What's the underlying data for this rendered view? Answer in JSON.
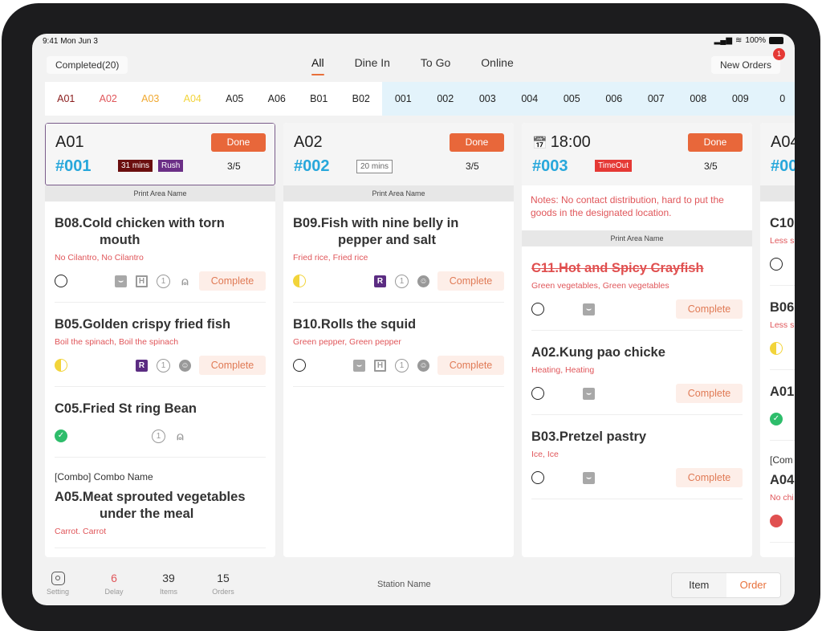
{
  "status_bar": {
    "time": "9:41 Mon Jun 3",
    "battery": "100%"
  },
  "top": {
    "completed": "Completed(20)",
    "tabs": [
      "All",
      "Dine In",
      "To Go",
      "Online"
    ],
    "active_tab": "All",
    "new_orders": "New Orders",
    "new_orders_badge": "1"
  },
  "tables_white": [
    {
      "label": "A01",
      "color": "#8a1c1c"
    },
    {
      "label": "A02",
      "color": "#e0565a"
    },
    {
      "label": "A03",
      "color": "#f0a830"
    },
    {
      "label": "A04",
      "color": "#f2d43a"
    },
    {
      "label": "A05",
      "color": "#222222"
    },
    {
      "label": "A06",
      "color": "#222222"
    },
    {
      "label": "B01",
      "color": "#222222"
    },
    {
      "label": "B02",
      "color": "#222222"
    }
  ],
  "tables_blue": [
    "001",
    "002",
    "003",
    "004",
    "005",
    "006",
    "007",
    "008",
    "009",
    "0"
  ],
  "colors": {
    "accent": "#e8673a",
    "order_number": "#27a7db",
    "modifier": "#e0565a",
    "done": "#2ebd6b"
  },
  "columns": [
    {
      "table": "A01",
      "order": "#001",
      "done": "Done",
      "count": "3/5",
      "selected": true,
      "tags": [
        {
          "text": "31 mins",
          "bg": "#6b0f0f",
          "fg": "#fff",
          "border": ""
        },
        {
          "text": "Rush",
          "bg": "#6b2f86",
          "fg": "#fff",
          "border": ""
        }
      ],
      "print_area": "Print Area Name",
      "items": [
        {
          "title": "B08.Cold chicken with torn mouth",
          "mods": "No Cilantro,  No Cilantro",
          "status": "empty",
          "icons": [
            "bag-icon",
            "h-icon",
            "one-icon",
            "person-icon"
          ],
          "complete": "Complete"
        },
        {
          "title": "B05.Golden crispy fried fish",
          "mods": "Boil the spinach,  Boil the spinach",
          "status": "half",
          "icons": [
            "r-icon",
            "one-icon",
            "face-icon"
          ],
          "complete": "Complete"
        },
        {
          "title": "C05.Fried St ring Bean",
          "status": "done",
          "icons": [
            "one-icon",
            "person-icon"
          ],
          "icons_center": true
        },
        {
          "combo": "[Combo] Combo Name",
          "title": "A05.Meat sprouted vegetables under the meal",
          "mods": "Carrot.  Carrot"
        }
      ]
    },
    {
      "table": "A02",
      "order": "#002",
      "done": "Done",
      "count": "3/5",
      "tags": [
        {
          "text": "20 mins",
          "bg": "#fff",
          "fg": "#666",
          "border": "1px solid #888"
        }
      ],
      "print_area": "Print Area Name",
      "items": [
        {
          "title": "B09.Fish with nine belly in pepper and salt",
          "mods": "Fried rice,  Fried rice",
          "status": "half",
          "icons": [
            "r-icon",
            "one-icon",
            "face-icon"
          ],
          "complete": "Complete"
        },
        {
          "title": "B10.Rolls the squid",
          "mods": "Green pepper,  Green pepper",
          "status": "empty",
          "icons": [
            "bag-icon",
            "h-icon",
            "one-icon",
            "face-icon"
          ],
          "complete": "Complete"
        }
      ]
    },
    {
      "table": "18:00",
      "calendar": true,
      "order": "#003",
      "done": "Done",
      "count": "3/5",
      "tags": [
        {
          "text": "TimeOut",
          "bg": "#e53935",
          "fg": "#fff",
          "border": ""
        }
      ],
      "notes": "Notes: No contact distribution, hard to put the goods in the designated location.",
      "print_area": "Print Area Name",
      "items": [
        {
          "title": "C11.Hot and Spicy Crayfish",
          "strike": true,
          "mods": "Green vegetables,  Green vegetables",
          "status": "empty",
          "icons": [
            "bag-icon"
          ],
          "icons_left": true,
          "complete": "Complete"
        },
        {
          "title": "A02.Kung pao chicke",
          "mods": "Heating,  Heating",
          "status": "empty",
          "icons": [
            "bag-icon"
          ],
          "icons_left": true,
          "complete": "Complete"
        },
        {
          "title": "B03.Pretzel pastry",
          "mods": "Ice,  Ice",
          "status": "empty",
          "icons": [
            "bag-icon"
          ],
          "icons_left": true,
          "complete": "Complete"
        }
      ]
    },
    {
      "table": "A04",
      "order": "#00",
      "tags": [],
      "print_area": "",
      "items": [
        {
          "title": "C10",
          "mods": "Less s",
          "status": "empty",
          "icons": []
        },
        {
          "title": "B06",
          "mods": "Less s",
          "status": "half",
          "icons": []
        },
        {
          "title": "A01",
          "status": "done",
          "icons": []
        },
        {
          "combo": "[Com",
          "title": "A04",
          "mods": "No chi",
          "status": "red",
          "icons": []
        }
      ]
    }
  ],
  "footer": {
    "setting": "Setting",
    "delay_value": "6",
    "delay_label": "Delay",
    "items_value": "39",
    "items_label": "Items",
    "orders_value": "15",
    "orders_label": "Orders",
    "station": "Station Name",
    "toggle": [
      "Item",
      "Order"
    ]
  }
}
